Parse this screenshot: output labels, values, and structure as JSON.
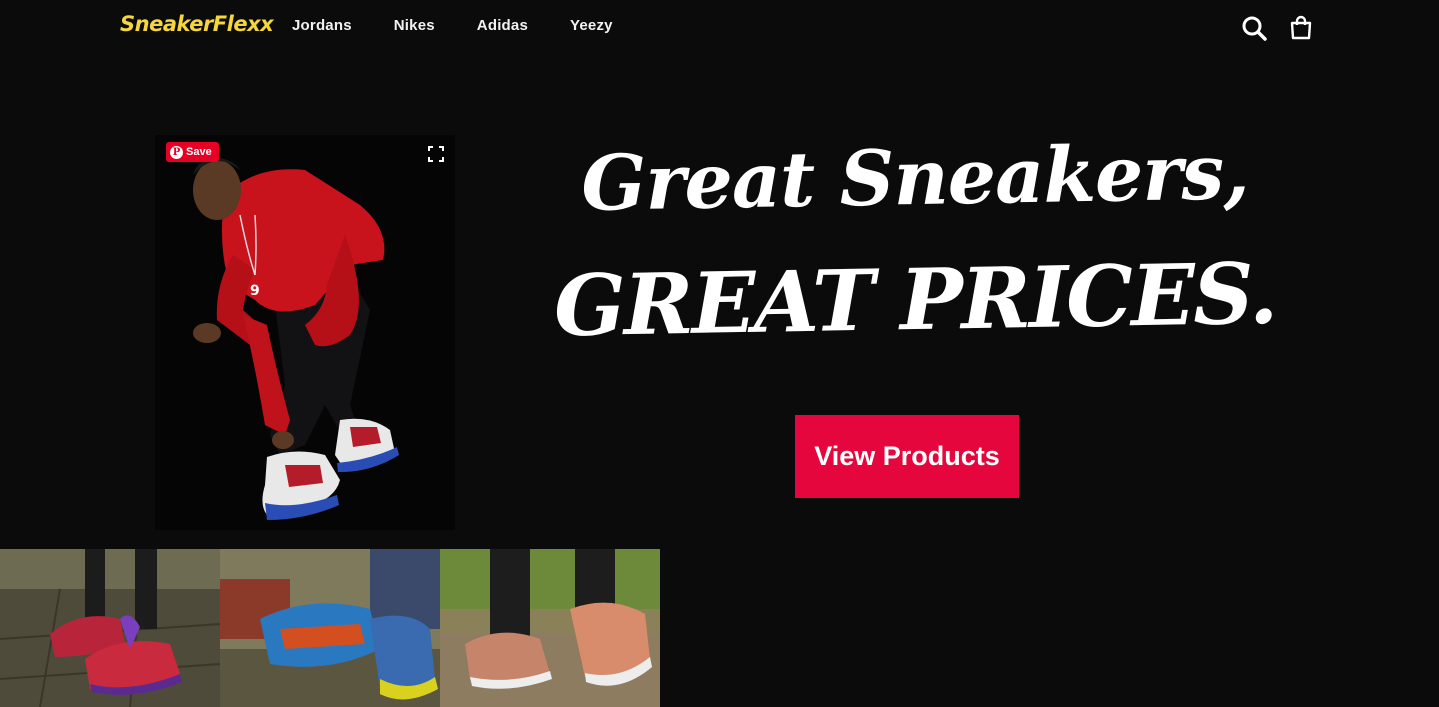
{
  "header": {
    "logo": "SneakerFlexx",
    "nav": [
      {
        "label": "Jordans"
      },
      {
        "label": "Nikes"
      },
      {
        "label": "Adidas"
      },
      {
        "label": "Yeezy"
      }
    ],
    "icons": [
      "search-icon",
      "cart-icon"
    ]
  },
  "hero": {
    "pin_save_label": "Save",
    "headline_line1": "Great Sneakers,",
    "headline_line2": "GREAT PRICES.",
    "cta_label": "View Products"
  },
  "colors": {
    "background": "#0b0b0c",
    "logo": "#f5d63b",
    "cta": "#e4063c",
    "pinterest": "#e60023"
  },
  "gallery": {
    "thumbnails": [
      "sneaker-photo-1",
      "sneaker-photo-2",
      "sneaker-photo-3"
    ]
  }
}
